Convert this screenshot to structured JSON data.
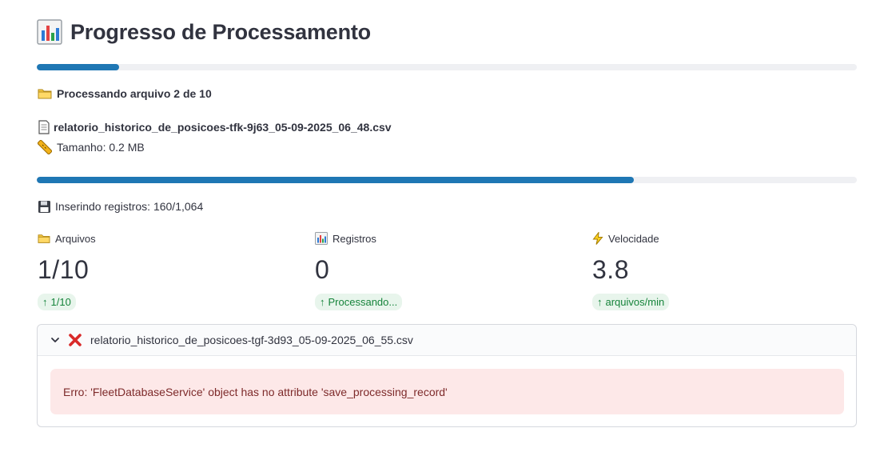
{
  "page": {
    "title": "Progresso de Processamento",
    "title_icon": "bar-chart-icon"
  },
  "overall_progress": {
    "fraction": 0.1
  },
  "file_status": {
    "processing_text": "Processando arquivo 2 de 10",
    "filename": "relatorio_historico_de_posicoes-tfk-9j63_05-09-2025_06_48.csv",
    "size_text": "Tamanho: 0.2 MB"
  },
  "insert_progress": {
    "fraction": 0.728,
    "text": "Inserindo registros: 160/1,064"
  },
  "metrics": [
    {
      "icon": "folder-icon",
      "label": "Arquivos",
      "value": "1/10",
      "delta": "1/10"
    },
    {
      "icon": "bar-chart-icon",
      "label": "Registros",
      "value": "0",
      "delta": "Processando..."
    },
    {
      "icon": "lightning-icon",
      "label": "Velocidade",
      "value": "3.8",
      "delta": "arquivos/min"
    }
  ],
  "expander": {
    "title": "relatorio_historico_de_posicoes-tgf-3d93_05-09-2025_06_55.csv",
    "expanded": true,
    "error_text": "Erro: 'FleetDatabaseService' object has no attribute 'save_processing_record'"
  },
  "colors": {
    "progress": "#1f77b4",
    "track": "#eff0f3",
    "delta_bg": "#e8f5ec",
    "delta_text": "#16843b",
    "error_bg": "#fde8e8",
    "error_text": "#7d2a2a"
  }
}
